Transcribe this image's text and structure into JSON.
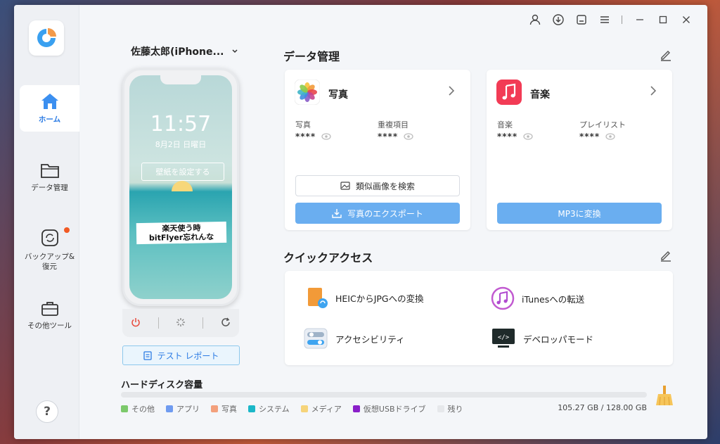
{
  "sidebar": {
    "items": [
      {
        "label": "ホーム"
      },
      {
        "label": "データ管理"
      },
      {
        "label": "バックアップ&\n復元"
      },
      {
        "label": "その他ツール"
      }
    ],
    "help": "?"
  },
  "device": {
    "name": "佐藤太郎(iPhone...",
    "clock": "11:57",
    "date": "8月2日 日曜日",
    "wallpaper_button": "壁紙を設定する",
    "banner_line1": "楽天使う時",
    "banner_line2": "bitFlyer忘れんな",
    "test_report": "テスト レポート"
  },
  "data_management": {
    "title": "データ管理",
    "photos": {
      "title": "写真",
      "stat1_label": "写真",
      "stat1_value": "****",
      "stat2_label": "重複項目",
      "stat2_value": "****",
      "search_button": "類似画像を検索",
      "export_button": "写真のエクスポート"
    },
    "music": {
      "title": "音楽",
      "stat1_label": "音楽",
      "stat1_value": "****",
      "stat2_label": "プレイリスト",
      "stat2_value": "****",
      "convert_button": "MP3に変換"
    }
  },
  "quick_access": {
    "title": "クイックアクセス",
    "items": [
      {
        "label": "HEICからJPGへの変換"
      },
      {
        "label": "iTunesへの転送"
      },
      {
        "label": "アクセシビリティ"
      },
      {
        "label": "デベロッパモード"
      }
    ]
  },
  "disk": {
    "title": "ハードディスク容量",
    "legend": [
      {
        "label": "その他",
        "color": "#7cc96b"
      },
      {
        "label": "アプリ",
        "color": "#6f9bf0"
      },
      {
        "label": "写真",
        "color": "#f3a07c"
      },
      {
        "label": "システム",
        "color": "#1bb7c8"
      },
      {
        "label": "メディア",
        "color": "#f6d47a"
      },
      {
        "label": "仮想USBドライブ",
        "color": "#8a1fc9"
      },
      {
        "label": "残り",
        "color": "#e6e8eb"
      }
    ],
    "size_text": "105.27 GB / 128.00 GB"
  },
  "colors": {
    "accent": "#2b7be4",
    "primary_button": "#6aaef0",
    "badge": "#f15a24"
  }
}
